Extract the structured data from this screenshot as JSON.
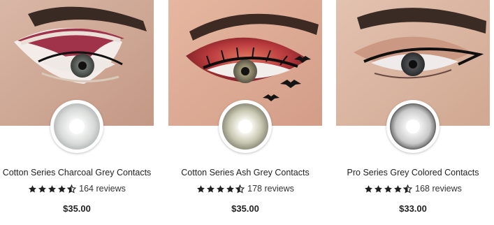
{
  "products": [
    {
      "title": "Cotton Series Charcoal Grey Contacts",
      "reviews": "164 reviews",
      "price": "$35.00",
      "rating": 4.5
    },
    {
      "title": "Cotton Series Ash Grey Contacts",
      "reviews": "178 reviews",
      "price": "$35.00",
      "rating": 4.5
    },
    {
      "title": "Pro Series Grey Colored Contacts",
      "reviews": "168 reviews",
      "price": "$33.00",
      "rating": 4.5
    }
  ],
  "colors": {
    "star": "#1f1f1f",
    "text": "#222222"
  }
}
